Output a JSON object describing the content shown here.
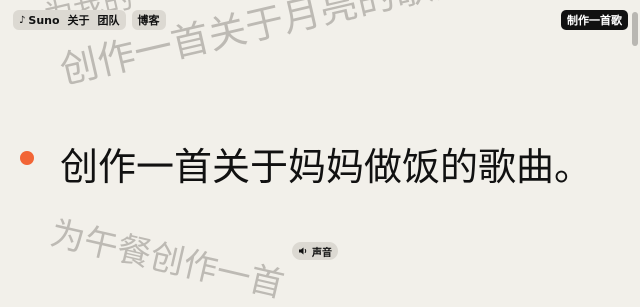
{
  "header": {
    "brand": "Suno",
    "brand_icon": "music-note-icon",
    "nav_items": [
      "关于",
      "团队"
    ],
    "blog": "博客",
    "cta": "制作一首歌"
  },
  "background_prompts": {
    "top_partial": "为我的",
    "top": "创作一首关于月亮的歌曲。",
    "bottom": "为午餐创作一首"
  },
  "main_prompt": {
    "text": "创作一首关于妈妈做饭的歌曲。",
    "dot_color": "#f26536"
  },
  "sound_button": {
    "label": "声音",
    "icon": "speaker-icon"
  },
  "colors": {
    "background": "#f2f0ea",
    "accent": "#f26536",
    "cta_background": "#111111"
  }
}
